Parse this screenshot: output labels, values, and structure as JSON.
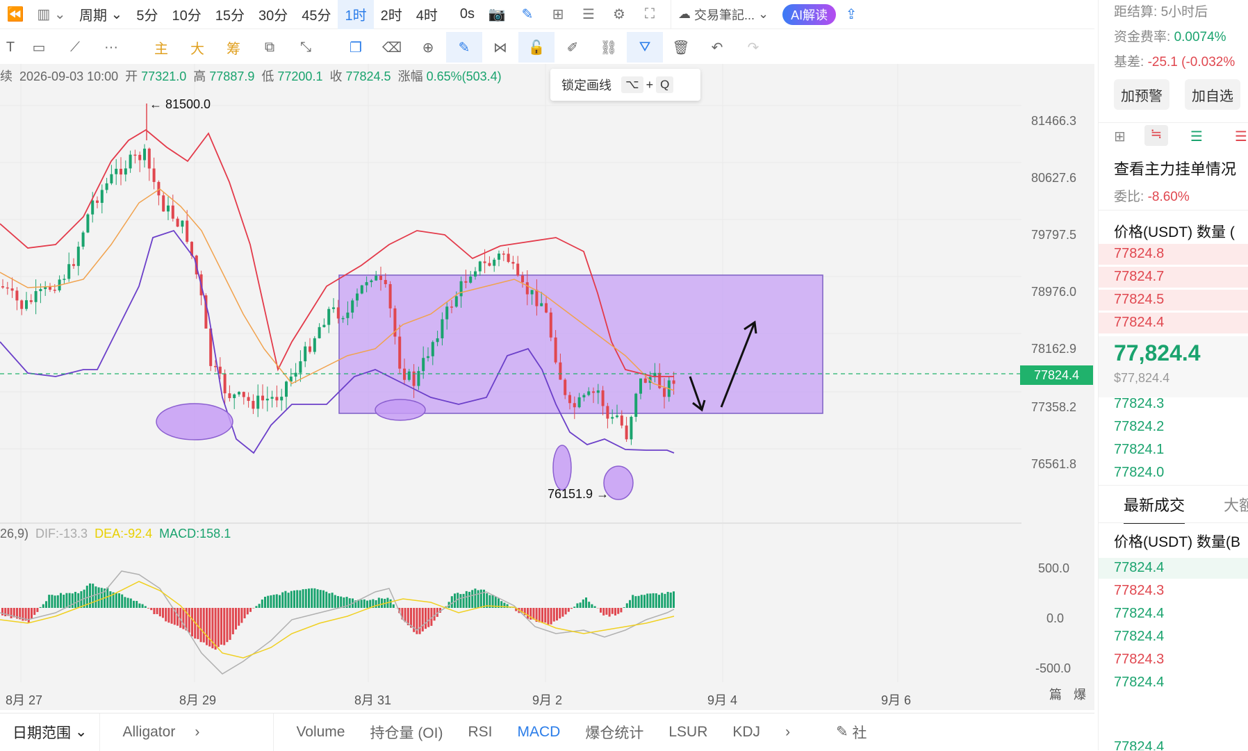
{
  "toolbar": {
    "intervals": [
      "5分",
      "10分",
      "15分",
      "30分",
      "45分",
      "1时",
      "2时",
      "4时"
    ],
    "active_interval": "1时",
    "period_label": "周期",
    "countdown": "0s",
    "journal_label": "交易筆記...",
    "ai_label": "AI解读"
  },
  "drawing_tools": {
    "main_label": "主",
    "big_label": "大",
    "chip_label": "筹",
    "more_label": "···"
  },
  "tooltip": {
    "label": "锁定画线",
    "key1": "⌥",
    "plus": "+",
    "key2": "Q"
  },
  "info": {
    "prefix": "续",
    "datetime": "2026-09-03 10:00",
    "open_label": "开",
    "open": "77321.0",
    "high_label": "高",
    "high": "77887.9",
    "low_label": "低",
    "low": "77200.1",
    "close_label": "收",
    "close": "77824.5",
    "change_label": "涨幅",
    "change": "0.65%(503.4)"
  },
  "chart_labels": {
    "high_marker": "← 81500.0",
    "low_marker": "76151.9 →"
  },
  "y_axis": [
    "81466.3",
    "80627.6",
    "79797.5",
    "78976.0",
    "78162.9",
    "77358.2",
    "76561.8"
  ],
  "current_price": "77824.4",
  "macd": {
    "params": "26,9)",
    "dif": "DIF:-13.3",
    "dea": "DEA:-92.4",
    "macd": "MACD:158.1",
    "axis": [
      "500.0",
      "0.0",
      "-500.0"
    ]
  },
  "x_axis": [
    "8月 27",
    "8月 29",
    "8月 31",
    "9月 2",
    "9月 4",
    "9月 6"
  ],
  "x_axis_right": {
    "a": "篇",
    "b": "爆"
  },
  "bottom_tabs": {
    "date_range": "日期范围",
    "alligator": "Alligator",
    "items": [
      "Volume",
      "持仓量 (OI)",
      "RSI",
      "MACD",
      "爆仓统计",
      "LSUR",
      "KDJ"
    ],
    "active": "MACD",
    "community": "社"
  },
  "colors": {
    "up": "#1aa36e",
    "down": "#e0474f",
    "accent": "#2b7de9",
    "box": "#c59cf5"
  },
  "right_panel": {
    "settle_label": "距结算:",
    "settle_value": "5小时后",
    "funding_label": "资金费率:",
    "funding_value": "0.0074%",
    "basis_label": "基差:",
    "basis_value": "-25.1 (-0.032%",
    "alert_button": "加预警",
    "watch_button": "加自选",
    "orders_title": "查看主力挂单情况",
    "ratio_label": "委比:",
    "ratio_value": "-8.60%",
    "book_header": "价格(USDT) 数量 (",
    "asks": [
      "77824.8",
      "77824.7",
      "77824.5",
      "77824.4"
    ],
    "last_price": "77,824.4",
    "last_usd": "$77,824.4",
    "bids": [
      "77824.3",
      "77824.2",
      "77824.1",
      "77824.0"
    ],
    "trades_tab": "最新成交",
    "trades_tab2": "大额",
    "trades_header": "价格(USDT) 数量(B",
    "trades": [
      {
        "price": "77824.4",
        "side": "buy"
      },
      {
        "price": "77824.3",
        "side": "sell"
      },
      {
        "price": "77824.4",
        "side": "buy"
      },
      {
        "price": "77824.4",
        "side": "buy"
      },
      {
        "price": "77824.3",
        "side": "sell"
      },
      {
        "price": "77824.4",
        "side": "buy"
      }
    ],
    "last_trade_partial": "77824.4"
  }
}
